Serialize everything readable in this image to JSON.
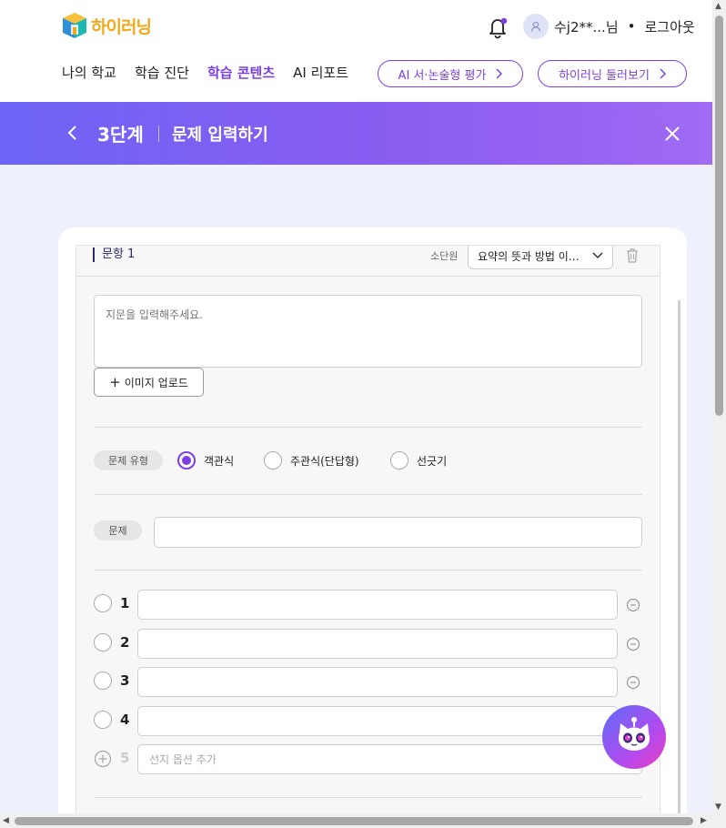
{
  "header": {
    "logo_text": "하이러닝",
    "user_label": "수j2**...님",
    "separator": "•",
    "logout": "로그아웃",
    "nav": [
      "나의 학교",
      "학습 진단",
      "학습 콘텐츠",
      "AI 리포트"
    ],
    "pill_ai": "AI 서·논술형 평가",
    "pill_tour": "하이러닝 둘러보기"
  },
  "banner": {
    "step": "3단계",
    "title": "문제 입력하기"
  },
  "question": {
    "label": "문항 1",
    "sub_unit_label": "소단원",
    "sub_unit_value": "요약의 뜻과 방법 이…",
    "passage_placeholder": "지문을 입력해주세요.",
    "upload_label": "이미지 업로드",
    "type_tag": "문제 유형",
    "types": [
      "객관식",
      "주관식(단답형)",
      "선긋기"
    ],
    "selected_type": "객관식",
    "question_tag": "문제",
    "options": [
      "1",
      "2",
      "3",
      "4"
    ],
    "add_number": "5",
    "add_placeholder": "선지 옵션 추가"
  },
  "colors": {
    "accent": "#7b3fe4",
    "logo": "#f0a91b",
    "banner_start": "#6d64f5",
    "banner_end": "#a06af4",
    "page_bg": "#eef0fb"
  },
  "icons": {
    "bell": "bell-icon",
    "avatar": "user-icon",
    "back": "chevron-left-icon",
    "close": "close-icon",
    "trash": "trash-icon",
    "minus": "minus-circle-icon",
    "plus": "plus-circle-icon",
    "mascot": "cat-chatbot-icon"
  }
}
